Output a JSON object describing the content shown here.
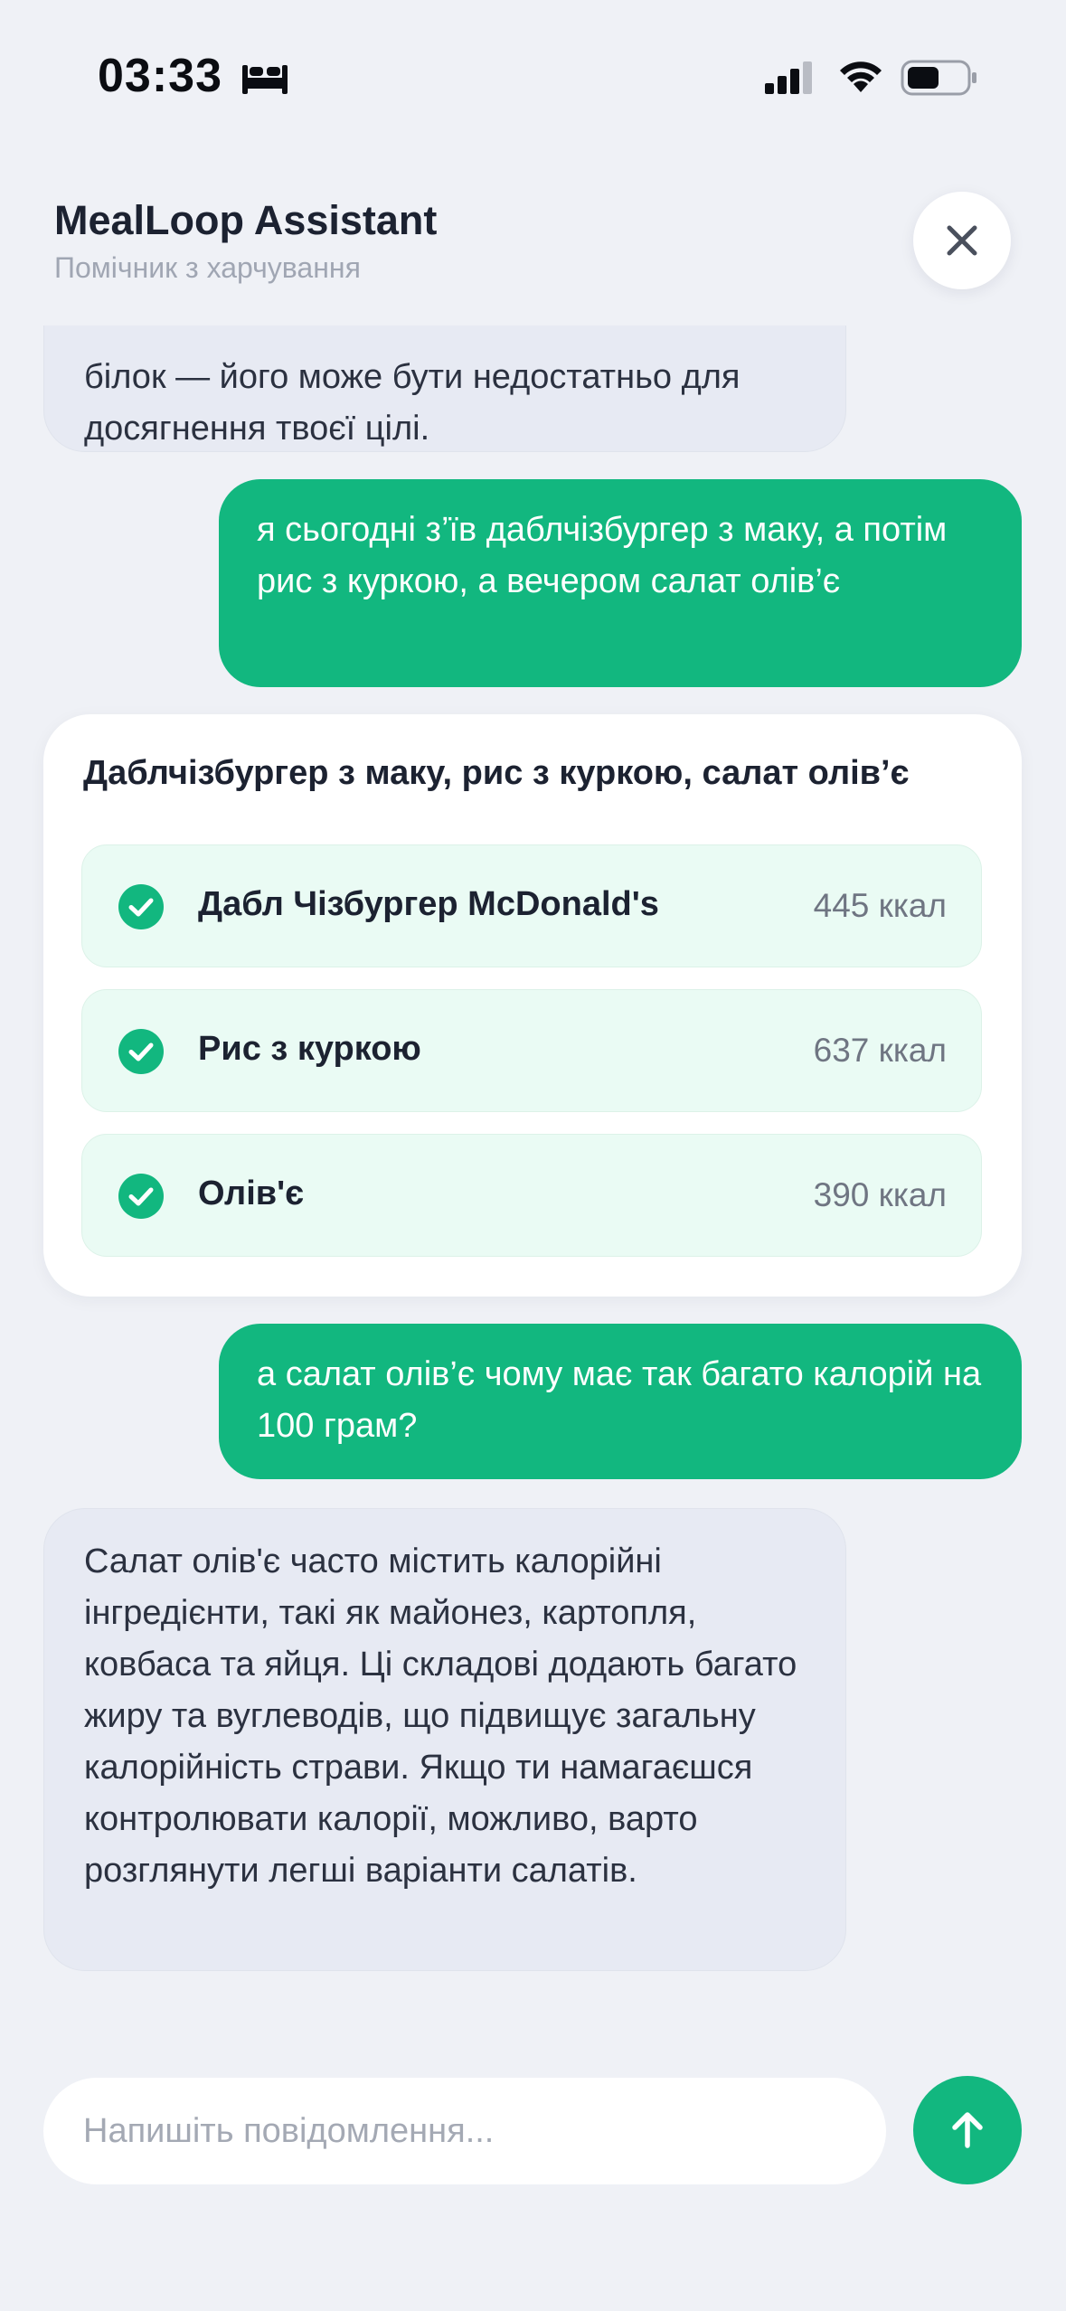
{
  "status_bar": {
    "time": "03:33",
    "focus_icon": "bed-icon",
    "signal_icon": "cellular-signal-icon",
    "wifi_icon": "wifi-icon",
    "battery_icon": "battery-icon"
  },
  "header": {
    "title": "MealLoop Assistant",
    "subtitle": "Помічник з харчування",
    "close_icon": "close-icon"
  },
  "messages": [
    {
      "role": "assistant",
      "text": "білок — його може бути недостатньо для досягнення твоєї цілі."
    },
    {
      "role": "user",
      "text": "я сьогодні з’їв даблчізбургер з маку, а потім рис з куркою, а вечером салат олів’є"
    },
    {
      "role": "assistant-card",
      "title": "Даблчізбургер з маку, рис з куркою, салат олів’є",
      "items": [
        {
          "name": "Дабл Чізбургер McDonald's",
          "kcal": "445 ккал"
        },
        {
          "name": "Рис з куркою",
          "kcal": "637 ккал"
        },
        {
          "name": "Олів'є",
          "kcal": "390 ккал"
        }
      ]
    },
    {
      "role": "user",
      "text": "а салат олів’є чому має так багато калорій на 100 грам?"
    },
    {
      "role": "assistant",
      "text": "Салат олів'є часто містить калорійні інгредієнти, такі як майонез, картопля, ковбаса та яйця. Ці складові додають багато жиру та вуглеводів, що підвищує загальну калорійність страви. Якщо ти намагаєшся контролювати калорії, можливо, варто розглянути легші варіанти салатів."
    }
  ],
  "composer": {
    "placeholder": "Напишіть повідомлення...",
    "value": "",
    "send_icon": "arrow-up-icon"
  },
  "colors": {
    "accent": "#12b77f",
    "background": "#eff1f6",
    "assistant_bubble": "#e7eaf3",
    "meal_item_bg": "#eafbf4"
  }
}
